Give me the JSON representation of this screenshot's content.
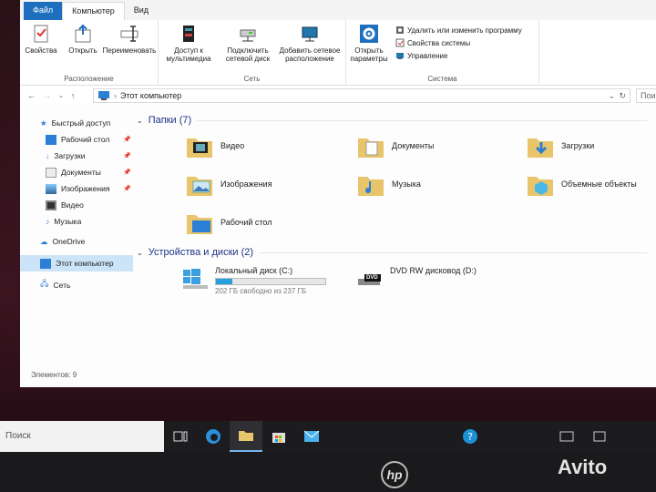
{
  "ribbon": {
    "tabs": [
      "Файл",
      "Компьютер",
      "Вид"
    ],
    "groups": [
      {
        "label": "Расположение",
        "buttons": [
          "Свойства",
          "Открыть",
          "Переименовать"
        ]
      },
      {
        "label": "Сеть",
        "buttons": [
          "Доступ к мультимедиа",
          "Подключить сетевой диск",
          "Добавить сетевое расположение"
        ]
      },
      {
        "label": "Система",
        "buttons": [
          "Открыть параметры"
        ],
        "small": [
          "Удалить или изменить программу",
          "Свойства системы",
          "Управление"
        ]
      }
    ]
  },
  "address": {
    "path": "Этот компьютер",
    "search_placeholder": "Пои"
  },
  "navpane": {
    "quick_access": "Быстрый доступ",
    "pinned": [
      "Рабочий стол",
      "Загрузки",
      "Документы",
      "Изображения"
    ],
    "unpinned": [
      "Видео",
      "Музыка"
    ],
    "onedrive": "OneDrive",
    "this_pc": "Этот компьютер",
    "network": "Сеть"
  },
  "content": {
    "folders_header": "Папки (7)",
    "folders": [
      "Видео",
      "Документы",
      "Загрузки",
      "Изображения",
      "Музыка",
      "Объемные объекты",
      "Рабочий стол"
    ],
    "devices_header": "Устройства и диски (2)",
    "drive_c": {
      "name": "Локальный диск (C:)",
      "free": "202 ГБ свободно из 237 ГБ",
      "used_fraction": 0.148
    },
    "drive_d": {
      "name": "DVD RW дисковод (D:)",
      "badge": "DVD"
    }
  },
  "status": "Элементов: 9",
  "taskbar": {
    "search": "Поиск"
  },
  "watermark": "Avito",
  "colors": {
    "accent": "#1f6fbf",
    "folder": "#e8c46a",
    "selection": "#cce4f7"
  }
}
